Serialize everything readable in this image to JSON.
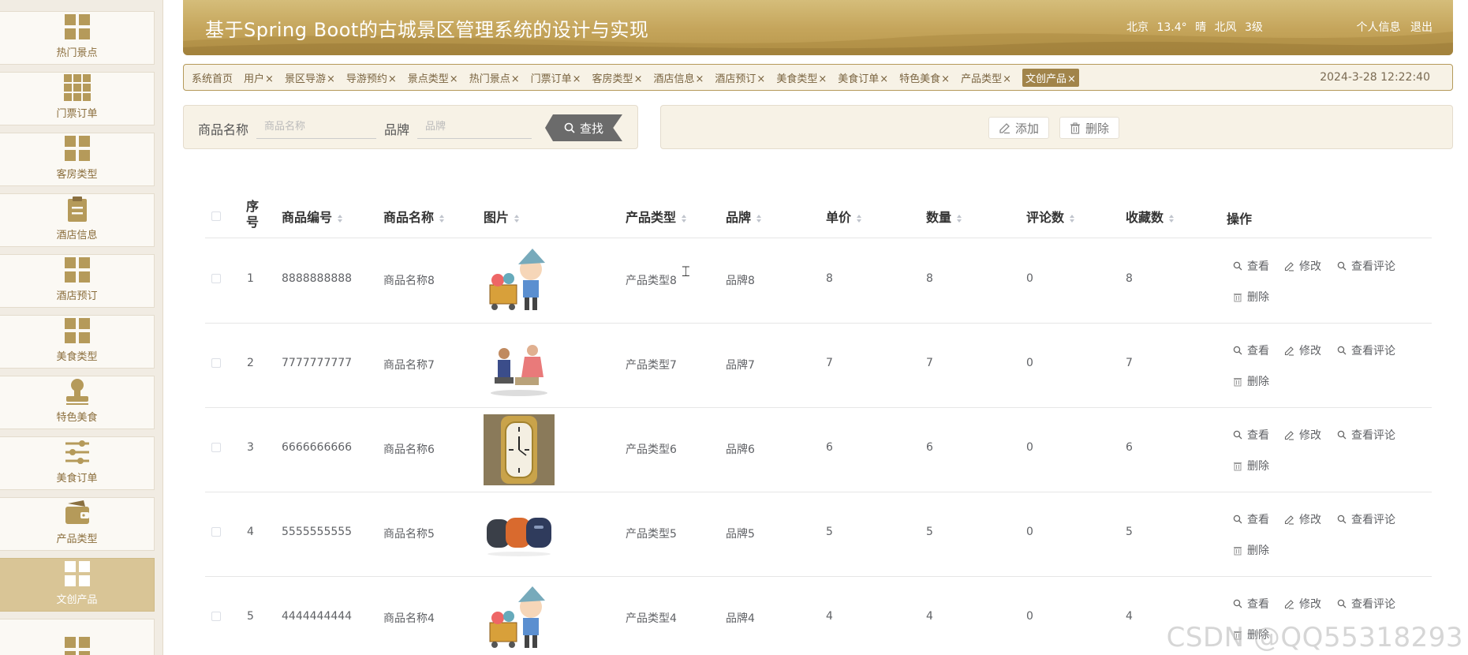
{
  "sidebar": {
    "items": [
      {
        "label": "热门景点",
        "icon": "grid-icon",
        "active": false
      },
      {
        "label": "门票订单",
        "icon": "grid9-icon",
        "active": false
      },
      {
        "label": "客房类型",
        "icon": "grid-icon",
        "active": false
      },
      {
        "label": "酒店信息",
        "icon": "clipboard-icon",
        "active": false
      },
      {
        "label": "酒店预订",
        "icon": "grid-icon",
        "active": false
      },
      {
        "label": "美食类型",
        "icon": "grid-icon",
        "active": false
      },
      {
        "label": "特色美食",
        "icon": "stamp-icon",
        "active": false
      },
      {
        "label": "美食订单",
        "icon": "sliders-icon",
        "active": false
      },
      {
        "label": "产品类型",
        "icon": "wallet-icon",
        "active": false
      },
      {
        "label": "文创产品",
        "icon": "grid-icon",
        "active": true
      },
      {
        "label": "",
        "icon": "grid-icon",
        "active": false
      }
    ]
  },
  "header": {
    "title": "基于Spring Boot的古城景区管理系统的设计与实现",
    "weather": {
      "city": "北京",
      "temp": "13.4°",
      "condition": "晴",
      "wind": "北风",
      "level": "3级"
    },
    "profile": "个人信息",
    "logout": "退出"
  },
  "tabs": [
    {
      "label": "系统首页",
      "close": ""
    },
    {
      "label": "用户",
      "close": "×"
    },
    {
      "label": "景区导游",
      "close": "×"
    },
    {
      "label": "导游预约",
      "close": "×"
    },
    {
      "label": "景点类型",
      "close": "×"
    },
    {
      "label": "热门景点",
      "close": "×"
    },
    {
      "label": "门票订单",
      "close": "×"
    },
    {
      "label": "客房类型",
      "close": "×"
    },
    {
      "label": "酒店信息",
      "close": "×"
    },
    {
      "label": "酒店预订",
      "close": "×"
    },
    {
      "label": "美食类型",
      "close": "×"
    },
    {
      "label": "美食订单",
      "close": "×"
    },
    {
      "label": "特色美食",
      "close": "×"
    },
    {
      "label": "产品类型",
      "close": "×"
    },
    {
      "label": "文创产品",
      "close": "×",
      "active": true
    }
  ],
  "datetime": "2024-3-28 12:22:40",
  "search": {
    "name_label": "商品名称",
    "name_placeholder": "商品名称",
    "brand_label": "品牌",
    "brand_placeholder": "品牌",
    "button": "查找"
  },
  "actions": {
    "add": "添加",
    "delete": "删除"
  },
  "table": {
    "headers": {
      "index": "序号",
      "code": "商品编号",
      "name": "商品名称",
      "image": "图片",
      "type": "产品类型",
      "brand": "品牌",
      "price": "单价",
      "qty": "数量",
      "comments": "评论数",
      "favorites": "收藏数",
      "ops": "操作"
    },
    "ops": {
      "view": "查看",
      "edit": "修改",
      "view_comments": "查看评论",
      "delete": "删除"
    },
    "rows": [
      {
        "index": "1",
        "code": "8888888888",
        "name": "商品名称8",
        "image": "cartoon-kids-image",
        "type": "产品类型8",
        "brand": "品牌8",
        "price": "8",
        "qty": "8",
        "comments": "0",
        "favorites": "8"
      },
      {
        "index": "2",
        "code": "7777777777",
        "name": "商品名称7",
        "image": "people-illustration-image",
        "type": "产品类型7",
        "brand": "品牌7",
        "price": "7",
        "qty": "7",
        "comments": "0",
        "favorites": "7"
      },
      {
        "index": "3",
        "code": "6666666666",
        "name": "商品名称6",
        "image": "gold-watch-image",
        "type": "产品类型6",
        "brand": "品牌6",
        "price": "6",
        "qty": "6",
        "comments": "0",
        "favorites": "6"
      },
      {
        "index": "4",
        "code": "5555555555",
        "name": "商品名称5",
        "image": "speakers-image",
        "type": "产品类型5",
        "brand": "品牌5",
        "price": "5",
        "qty": "5",
        "comments": "0",
        "favorites": "5"
      },
      {
        "index": "5",
        "code": "4444444444",
        "name": "商品名称4",
        "image": "cartoon-kids-image",
        "type": "产品类型4",
        "brand": "品牌4",
        "price": "4",
        "qty": "4",
        "comments": "0",
        "favorites": "4"
      }
    ]
  },
  "watermark": "CSDN @QQ55318293",
  "colors": {
    "accent": "#c4a45a",
    "active_tab": "#a1844a",
    "sidebar_active": "#d9c596"
  }
}
